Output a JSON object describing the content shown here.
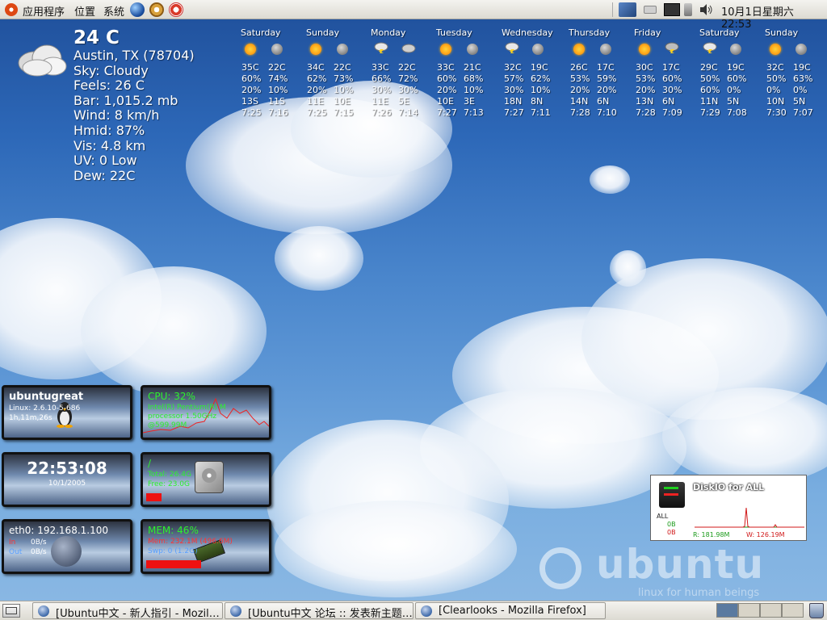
{
  "top_panel": {
    "menu_applications": "应用程序",
    "menu_places": "位置",
    "menu_system": "系统",
    "clock": "10月1日星期六 22:53"
  },
  "weather": {
    "temp": "24 C",
    "location": "Austin, TX (78704)",
    "sky": "Sky: Cloudy",
    "feels": "Feels: 26 C",
    "bar": "Bar: 1,015.2 mb",
    "wind": "Wind: 8 km/h",
    "hmid": "Hmid: 87%",
    "vis": "Vis: 4.8 km",
    "uv": "UV: 0 Low",
    "dew": "Dew: 22C",
    "forecast": [
      {
        "day": "Saturday",
        "d_icon": "sun",
        "n_icon": "moon",
        "hi": "35C",
        "lo": "22C",
        "p1": "60%",
        "p2": "74%",
        "p3": "20%",
        "p4": "10%",
        "w1": "13S",
        "w2": "11S",
        "t1": "7:25",
        "t2": "7:16"
      },
      {
        "day": "Sunday",
        "d_icon": "sun-cloud",
        "n_icon": "moon",
        "hi": "34C",
        "lo": "22C",
        "p1": "62%",
        "p2": "73%",
        "p3": "20%",
        "p4": "10%",
        "w1": "11E",
        "w2": "10E",
        "t1": "7:25",
        "t2": "7:15"
      },
      {
        "day": "Monday",
        "d_icon": "storm",
        "n_icon": "cloud",
        "hi": "33C",
        "lo": "22C",
        "p1": "66%",
        "p2": "72%",
        "p3": "30%",
        "p4": "30%",
        "w1": "11E",
        "w2": "5E",
        "t1": "7:26",
        "t2": "7:14"
      },
      {
        "day": "Tuesday",
        "d_icon": "sun",
        "n_icon": "moon",
        "hi": "33C",
        "lo": "21C",
        "p1": "60%",
        "p2": "68%",
        "p3": "20%",
        "p4": "10%",
        "w1": "10E",
        "w2": "3E",
        "t1": "7:27",
        "t2": "7:13"
      },
      {
        "day": "Wednesday",
        "d_icon": "storm",
        "n_icon": "moon",
        "hi": "32C",
        "lo": "19C",
        "p1": "57%",
        "p2": "62%",
        "p3": "30%",
        "p4": "10%",
        "w1": "18N",
        "w2": "8N",
        "t1": "7:27",
        "t2": "7:11"
      },
      {
        "day": "Thursday",
        "d_icon": "sun",
        "n_icon": "moon",
        "hi": "26C",
        "lo": "17C",
        "p1": "53%",
        "p2": "59%",
        "p3": "20%",
        "p4": "20%",
        "w1": "14N",
        "w2": "6N",
        "t1": "7:28",
        "t2": "7:10"
      },
      {
        "day": "Friday",
        "d_icon": "sun",
        "n_icon": "storm",
        "hi": "30C",
        "lo": "17C",
        "p1": "53%",
        "p2": "60%",
        "p3": "20%",
        "p4": "30%",
        "w1": "13N",
        "w2": "6N",
        "t1": "7:28",
        "t2": "7:09"
      },
      {
        "day": "Saturday",
        "d_icon": "storm",
        "n_icon": "moon",
        "hi": "29C",
        "lo": "19C",
        "p1": "50%",
        "p2": "60%",
        "p3": "60%",
        "p4": "0%",
        "w1": "11N",
        "w2": "5N",
        "t1": "7:29",
        "t2": "7:08"
      },
      {
        "day": "Sunday",
        "d_icon": "sun",
        "n_icon": "moon",
        "hi": "32C",
        "lo": "19C",
        "p1": "50%",
        "p2": "63%",
        "p3": "0%",
        "p4": "0%",
        "w1": "10N",
        "w2": "5N",
        "t1": "7:30",
        "t2": "7:07"
      }
    ]
  },
  "widgets": {
    "host": {
      "name": "ubuntugreat",
      "kernel": "Linux: 2.6.10-5-686",
      "uptime": "1h,11m,26s"
    },
    "cpu": {
      "label": "CPU:",
      "value": "32%",
      "model": "Intel(R) Pentium(R) M",
      "line2": "processor 1.50GHz",
      "line3": "@599.99M"
    },
    "clock": {
      "time": "22:53:08",
      "date": "10/1/2005"
    },
    "disk": {
      "mount": "/",
      "total": "Total: 26.4G",
      "free": "Free: 23.0G",
      "used_fraction": 0.13
    },
    "net": {
      "iface": "eth0:",
      "ip": "192.168.1.100",
      "in_label": "In",
      "in": "0B/s",
      "out_label": "Out",
      "out": "0B/s"
    },
    "mem": {
      "label": "MEM:",
      "value": "46%",
      "mem_line": "Mem: 232.1M (496.6M)",
      "swp_line": "Swp: 0 (1.2G)",
      "used_fraction": 0.46
    }
  },
  "diskio": {
    "title": "DiskIO for ALL",
    "all_label": "ALL",
    "read_val": "0B",
    "write_val": "0B",
    "read_total": "R: 181.98M",
    "write_total": "W: 126.19M"
  },
  "ubuntu_logo": {
    "word": "ubuntu",
    "tagline": "linux for human beings"
  },
  "taskbar": {
    "tasks": [
      "[Ubuntu中文 - 新人指引 - Mozil…",
      "[Ubuntu中文 论坛 :: 发表新主题…",
      "[Clearlooks - Mozilla Firefox]"
    ]
  }
}
